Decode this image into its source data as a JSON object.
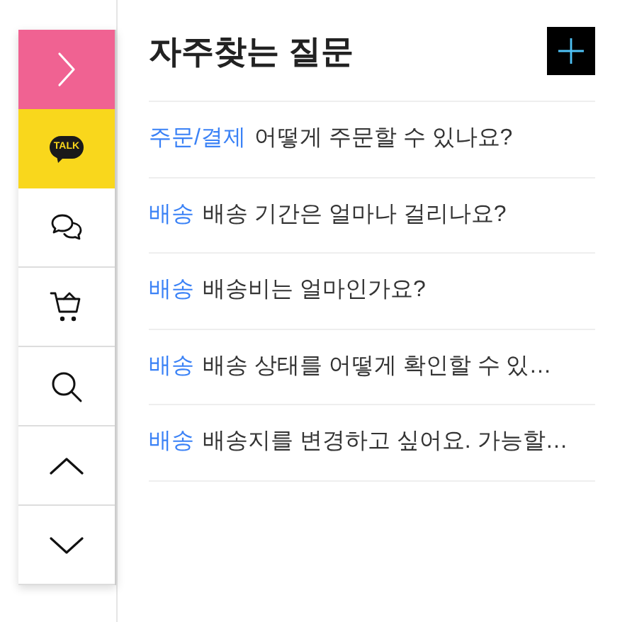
{
  "sidebar": {
    "buttons": [
      {
        "kind": "toggle"
      },
      {
        "kind": "kakao",
        "label": "TALK"
      },
      {
        "kind": "chat"
      },
      {
        "kind": "cart"
      },
      {
        "kind": "search"
      },
      {
        "kind": "up"
      },
      {
        "kind": "down"
      }
    ]
  },
  "title": "자주찾는 질문",
  "faq": [
    {
      "category": "주문/결제",
      "question": "어떻게 주문할 수 있나요?"
    },
    {
      "category": "배송",
      "question": "배송 기간은 얼마나 걸리나요?"
    },
    {
      "category": "배송",
      "question": "배송비는 얼마인가요?"
    },
    {
      "category": "배송",
      "question": "배송 상태를 어떻게 확인할 수 있…"
    },
    {
      "category": "배송",
      "question": "배송지를 변경하고 싶어요. 가능할…"
    }
  ]
}
